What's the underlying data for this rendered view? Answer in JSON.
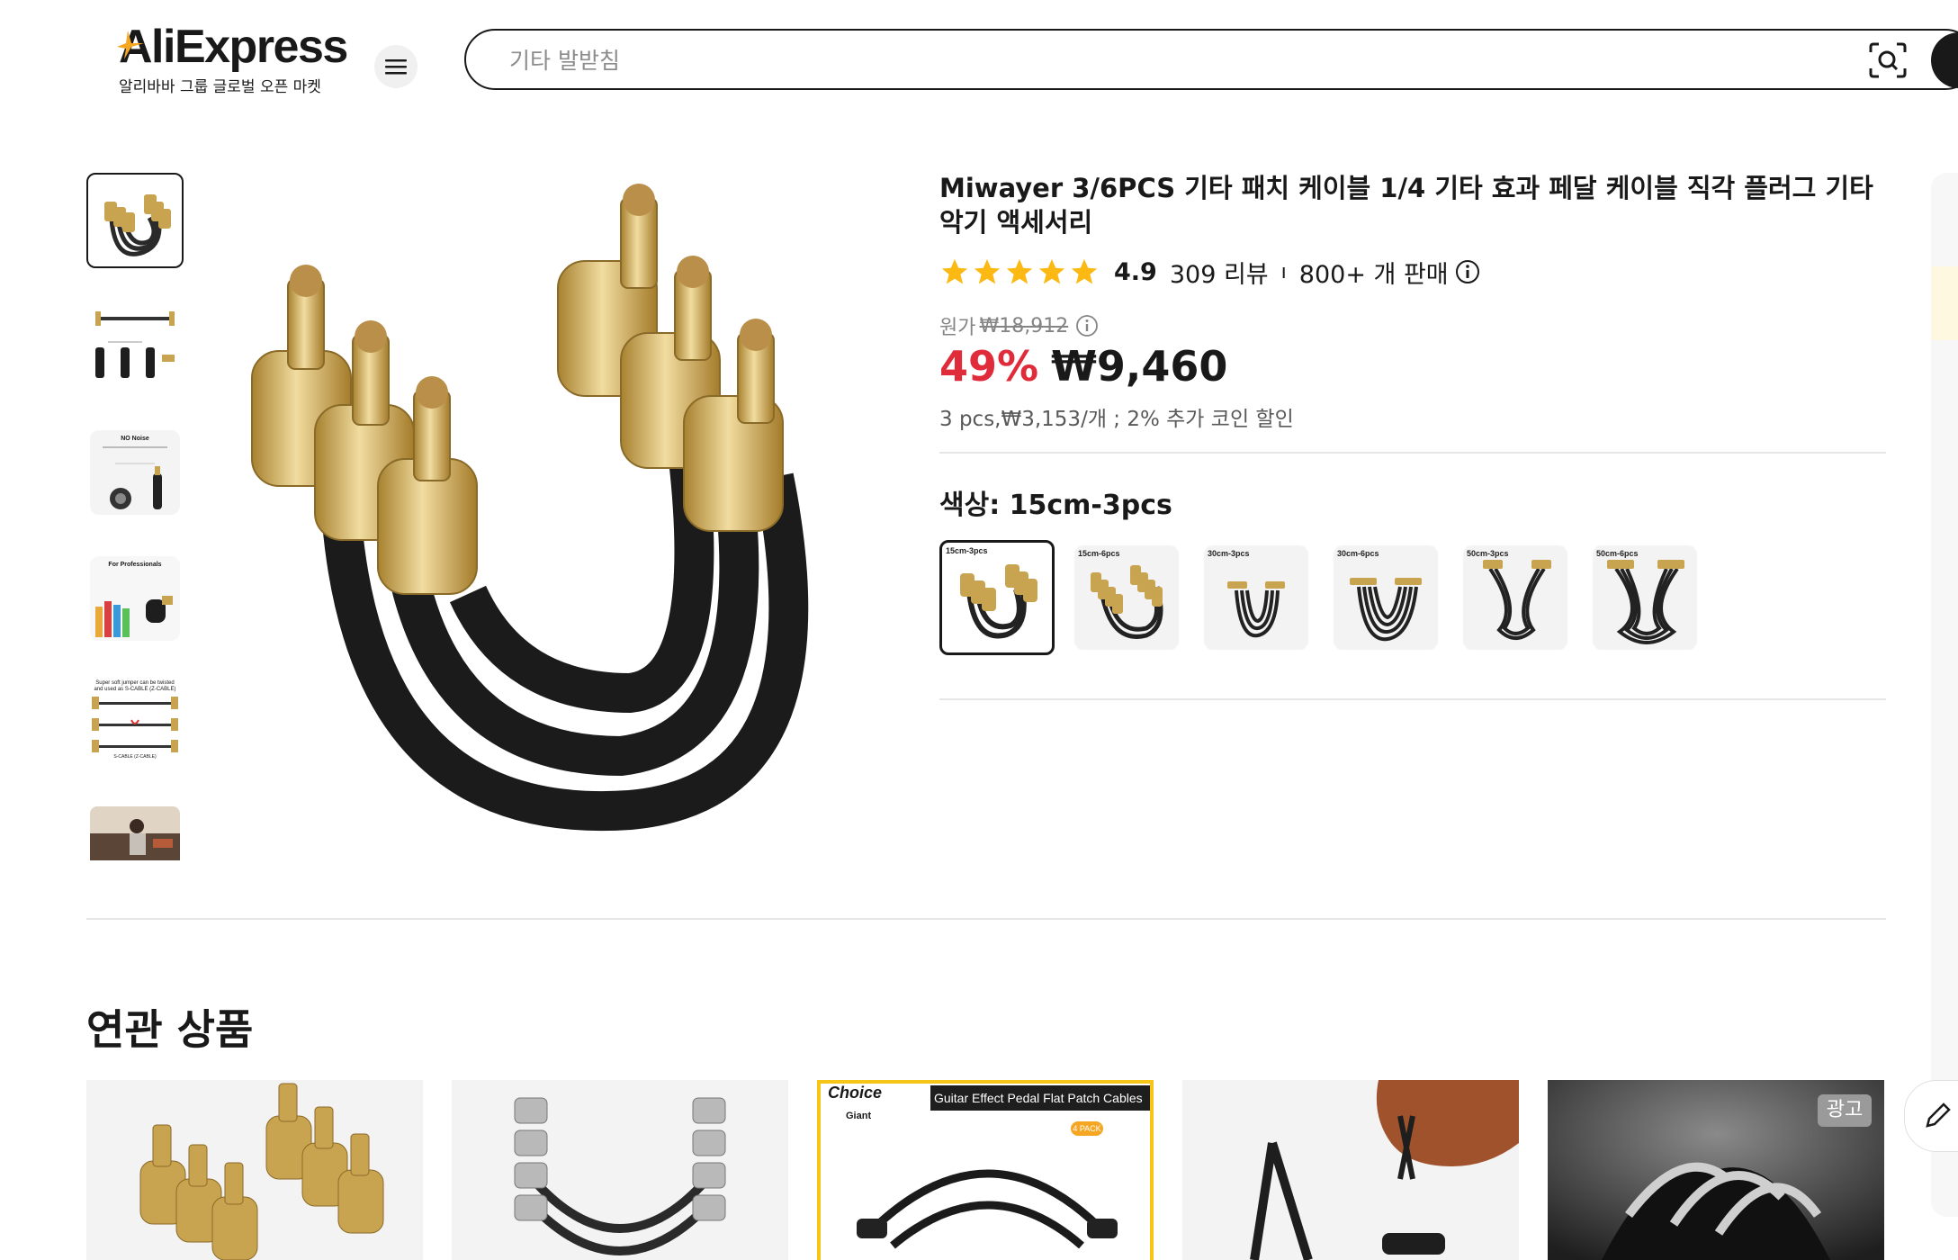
{
  "header": {
    "logo_text": "AliExpress",
    "logo_subtitle": "알리바바 그룹 글로벌 오픈 마켓",
    "menu_icon": "hamburger-icon",
    "search_placeholder": "기타 발받침",
    "camera_icon": "camera-search-icon"
  },
  "product": {
    "title": "Miwayer 3/6PCS 기타 패치 케이블 1/4 기타 효과 페달 케이블 직각 플러그 기타 악기 액세서리",
    "rating": "4.9",
    "stars": 5,
    "reviews": "309 리뷰",
    "separator": "ı",
    "sold": "800+ 개 판매",
    "original_label": "원가",
    "original_price": "₩18,912",
    "discount": "49%",
    "price": "₩9,460",
    "coin_note": "3 pcs,₩3,153/개 ; 2% 추가 코인 할인",
    "color_label": "색상: 15cm-3pcs",
    "swatches": [
      {
        "caption": "15cm-3pcs",
        "selected": true
      },
      {
        "caption": "15cm-6pcs",
        "selected": false
      },
      {
        "caption": "30cm-3pcs",
        "selected": false
      },
      {
        "caption": "30cm-6pcs",
        "selected": false
      },
      {
        "caption": "50cm-3pcs",
        "selected": false
      },
      {
        "caption": "50cm-6pcs",
        "selected": false
      }
    ]
  },
  "thumbnails": [
    {
      "name": "thumb-gold-cables",
      "selected": true
    },
    {
      "name": "thumb-dimensions"
    },
    {
      "name": "thumb-no-noise"
    },
    {
      "name": "thumb-for-professionals"
    },
    {
      "name": "thumb-s-cable"
    },
    {
      "name": "thumb-guitarist"
    }
  ],
  "thumb_texts": {
    "no_noise": "NO Noise",
    "for_pro": "For Professionals",
    "s_cable": "Super soft jumper can be twisted and used as S-CABLE (Z-CABLE)",
    "s_cable_label": "S-CABLE (Z-CABLE)"
  },
  "related": {
    "title": "연관 상품",
    "cards": [
      {
        "name": "related-card-gold-cables"
      },
      {
        "name": "related-card-silver-cables"
      },
      {
        "name": "related-card-choice",
        "badge": "Choice",
        "brand": "Giant",
        "banner": "Guitar Effect Pedal Flat Patch Cables",
        "pack": "4 PACK"
      },
      {
        "name": "related-card-guitar-stand"
      },
      {
        "name": "related-card-ad",
        "ad_label": "광고"
      }
    ]
  },
  "colors": {
    "accent_red": "#e02b3a",
    "text_dark": "#191919",
    "star_yellow": "#fdb913",
    "choice_yellow": "#f5c518"
  }
}
